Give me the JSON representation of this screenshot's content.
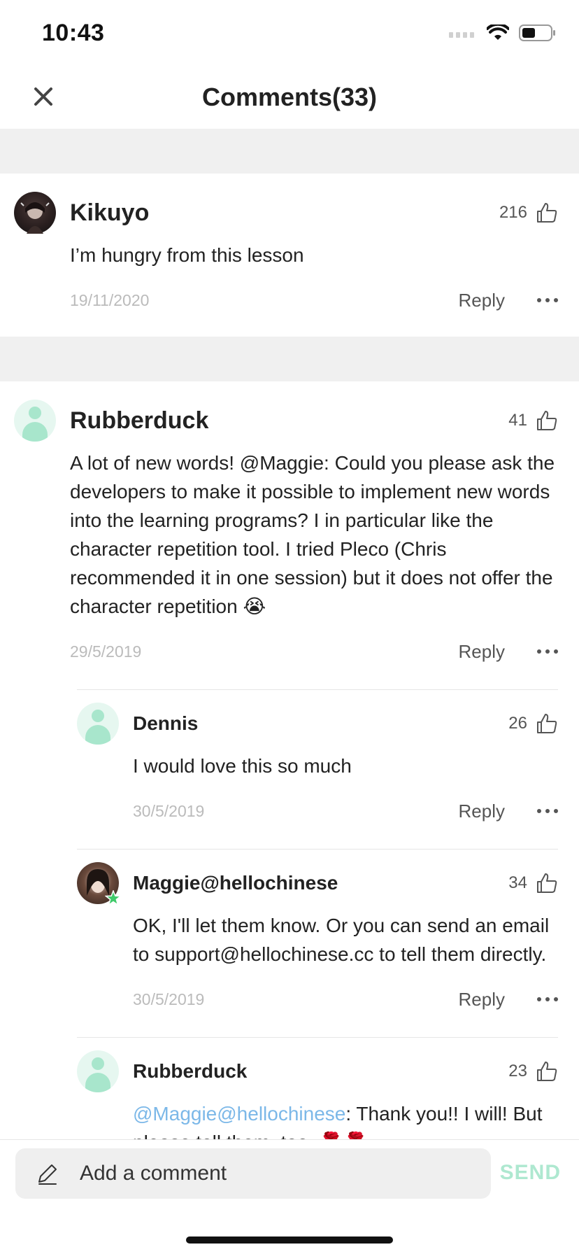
{
  "status": {
    "time": "10:43"
  },
  "header": {
    "title": "Comments(33)"
  },
  "comments": [
    {
      "author": "Kikuyo",
      "likes": "216",
      "text": "I’m hungry from this lesson",
      "date": "19/11/2020",
      "reply_label": "Reply"
    },
    {
      "author": "Rubberduck",
      "likes": "41",
      "text": "A lot of new words! @Maggie: Could you please ask the developers to make it possible to implement new words into the learning programs? I in particular like the character repetition tool. I tried Pleco (Chris recommended it in one session) but it does not offer the character repetition 😭",
      "date": "29/5/2019",
      "reply_label": "Reply",
      "replies": [
        {
          "author": "Dennis",
          "likes": "26",
          "text": "I would love this so much",
          "date": "30/5/2019",
          "reply_label": "Reply"
        },
        {
          "author": "Maggie@hellochinese",
          "likes": "34",
          "text": "OK, I'll let them know. Or you can send an email to support@hellochinese.cc to tell them directly.",
          "date": "30/5/2019",
          "reply_label": "Reply"
        },
        {
          "author": "Rubberduck",
          "likes": "23",
          "mention": "@Maggie@hellochinese",
          "text": ": Thank you!! I will! But please tell them, too. 🌹🌹"
        }
      ]
    }
  ],
  "composer": {
    "placeholder": "Add a comment",
    "send_label": "SEND"
  },
  "colors": {
    "accent": "#aee8d0",
    "mention": "#7cb8e8",
    "divider": "#f0f0f0"
  }
}
